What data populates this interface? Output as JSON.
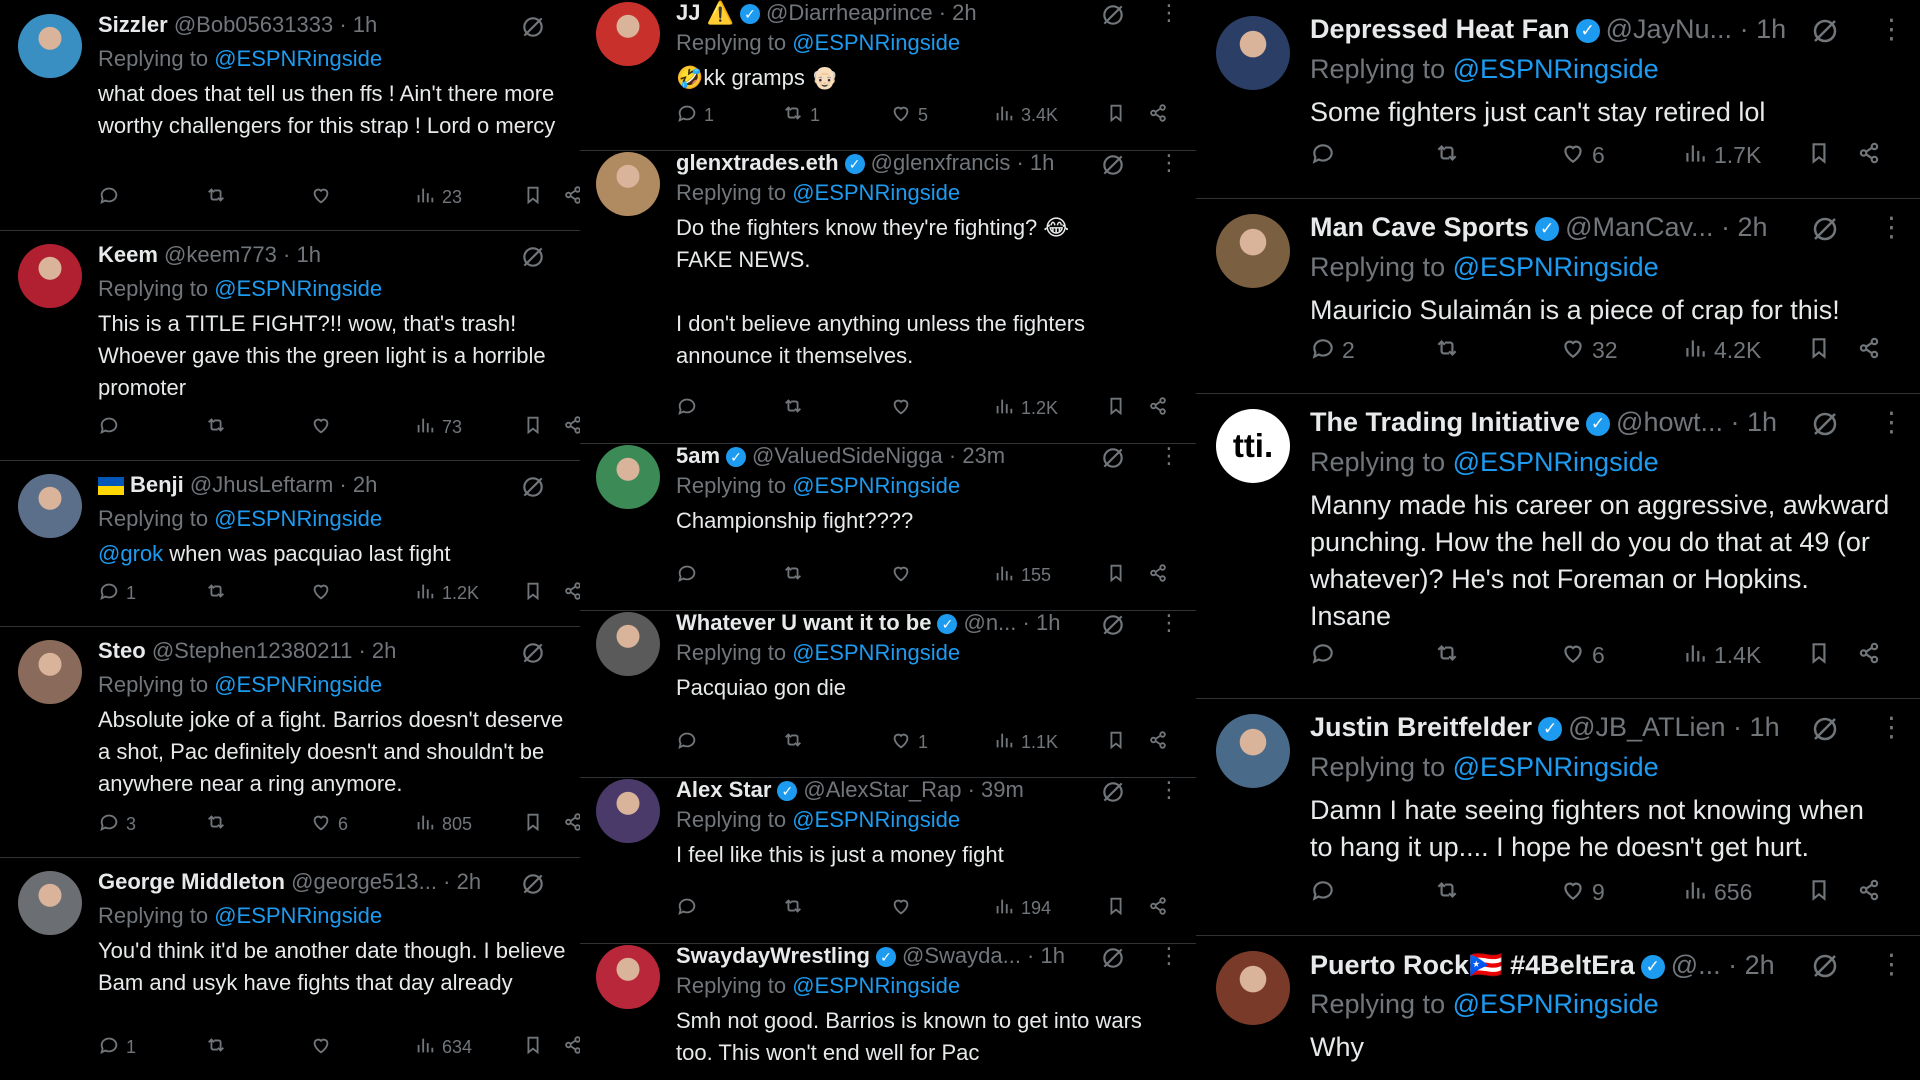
{
  "common": {
    "replying_prefix": "Replying to",
    "replying_handle": "@ESPNRingside"
  },
  "colors": {
    "background": "#000000",
    "text": "#e7e9ea",
    "muted": "#71767b",
    "link": "#1d9bf0",
    "border": "#2f3336"
  },
  "columns": [
    {
      "tweets": [
        {
          "name": "Sizzler",
          "handle": "@Bob05631333",
          "time": "1h",
          "verified": false,
          "text": "what does that tell us then ffs ! Ain't there more worthy challengers for this strap ! Lord o mercy",
          "replies": "",
          "reposts": "",
          "likes": "",
          "views": "23",
          "avatar_color": "#3a8fc2"
        },
        {
          "name": "Keem",
          "handle": "@keem773",
          "time": "1h",
          "verified": false,
          "text": "This is a TITLE FIGHT?!! wow, that's trash! Whoever gave this the green light is a horrible promoter",
          "replies": "",
          "reposts": "",
          "likes": "",
          "views": "73",
          "avatar_color": "#b02030"
        },
        {
          "name": "Benji",
          "handle": "@JhusLeftarm",
          "time": "2h",
          "verified": false,
          "flag": "ukraine",
          "mention": "@grok",
          "text": " when was pacquiao last fight",
          "replies": "1",
          "reposts": "",
          "likes": "",
          "views": "1.2K",
          "avatar_color": "#5c6f8a"
        },
        {
          "name": "Steo",
          "handle": "@Stephen12380211",
          "time": "2h",
          "verified": false,
          "text": "Absolute joke of a fight. Barrios doesn't deserve a shot, Pac definitely doesn't and shouldn't be anywhere near a ring anymore.",
          "replies": "3",
          "reposts": "",
          "likes": "6",
          "views": "805",
          "avatar_color": "#8a6a5a"
        },
        {
          "name": "George Middleton",
          "handle": "@george513...",
          "time": "2h",
          "verified": false,
          "text": "You'd think it'd be another date though. I believe Bam and usyk have fights that day already",
          "replies": "1",
          "reposts": "",
          "likes": "",
          "views": "634",
          "avatar_color": "#6b6f73"
        }
      ]
    },
    {
      "tweets": [
        {
          "name": "JJ ⚠️",
          "handle": "@Diarrheaprince",
          "time": "2h",
          "verified": true,
          "text": "🤣kk gramps 👴🏻",
          "replies": "1",
          "reposts": "1",
          "likes": "5",
          "views": "3.4K",
          "avatar_color": "#c8302b"
        },
        {
          "name": "glenxtrades.eth",
          "handle": "@glenxfrancis",
          "time": "1h",
          "verified": true,
          "text": "Do the fighters know they're fighting? 😂\nFAKE NEWS.\n\nI don't believe anything unless the fighters announce it themselves.",
          "replies": "",
          "reposts": "",
          "likes": "",
          "views": "1.2K",
          "avatar_color": "#b08a60"
        },
        {
          "name": "5am",
          "handle": "@ValuedSideNigga",
          "time": "23m",
          "verified": true,
          "text": "Championship fight????",
          "replies": "",
          "reposts": "",
          "likes": "",
          "views": "155",
          "avatar_color": "#3c8a56"
        },
        {
          "name": "Whatever U want it to be",
          "handle": "@n...",
          "time": "1h",
          "verified": true,
          "text": "Pacquiao gon die",
          "replies": "",
          "reposts": "",
          "likes": "1",
          "views": "1.1K",
          "avatar_color": "#5a5a5a"
        },
        {
          "name": "Alex Star",
          "handle": "@AlexStar_Rap",
          "time": "39m",
          "verified": true,
          "text": "I feel like this is just a money fight",
          "replies": "",
          "reposts": "",
          "likes": "",
          "views": "194",
          "avatar_color": "#4a3a6a"
        },
        {
          "name": "SwaydayWrestling",
          "handle": "@Swayda...",
          "time": "1h",
          "verified": true,
          "text": "Smh not good. Barrios is known to get into wars too. This won't end well for Pac",
          "replies": "",
          "reposts": "",
          "likes": "",
          "views": "",
          "avatar_color": "#b8283a"
        }
      ]
    },
    {
      "tweets": [
        {
          "name": "Depressed Heat Fan",
          "handle": "@JayNu...",
          "time": "1h",
          "verified": true,
          "text": "Some fighters just can't stay retired lol",
          "replies": "",
          "reposts": "",
          "likes": "6",
          "views": "1.7K",
          "avatar_color": "#2b3e66"
        },
        {
          "name": "Man Cave Sports",
          "handle": "@ManCav...",
          "time": "2h",
          "verified": true,
          "text": "Mauricio Sulaimán is a piece of crap for this!",
          "replies": "2",
          "reposts": "",
          "likes": "32",
          "views": "4.2K",
          "avatar_color": "#7a6040"
        },
        {
          "name": "The Trading Initiative",
          "handle": "@howt...",
          "time": "1h",
          "verified": true,
          "logo_text": "tti.",
          "text": "Manny made his career on aggressive, awkward punching. How the hell do you do that at 49 (or whatever)? He's not Foreman or Hopkins. Insane",
          "replies": "",
          "reposts": "",
          "likes": "6",
          "views": "1.4K",
          "avatar_color": "#ffffff"
        },
        {
          "name": "Justin Breitfelder",
          "handle": "@JB_ATLien",
          "time": "1h",
          "verified": true,
          "text": "Damn I hate seeing fighters not knowing when to hang it up....   I hope he doesn't get hurt.",
          "replies": "",
          "reposts": "",
          "likes": "9",
          "views": "656",
          "avatar_color": "#4a6a8a"
        },
        {
          "name": "Puerto Rock🇵🇷 #4BeltEra",
          "handle": "@...",
          "time": "2h",
          "verified": true,
          "text": "Why",
          "replies": "",
          "reposts": "",
          "likes": "",
          "views": "",
          "avatar_color": "#7a3a2a"
        }
      ]
    }
  ]
}
